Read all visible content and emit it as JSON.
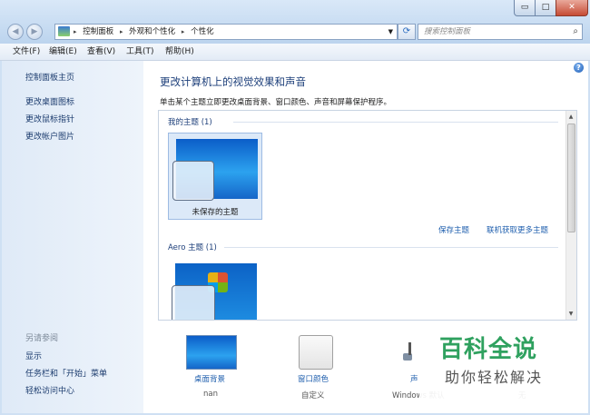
{
  "window": {
    "controls": {
      "minimize": "▭",
      "maximize": "□",
      "close": "✕"
    }
  },
  "address_bar": {
    "crumbs": [
      "控制面板",
      "外观和个性化",
      "个性化"
    ],
    "separator": "▸",
    "search_placeholder": "搜索控制面板"
  },
  "menu": {
    "file": "文件(F)",
    "edit": "编辑(E)",
    "view": "查看(V)",
    "tools": "工具(T)",
    "help": "帮助(H)"
  },
  "sidebar": {
    "home": "控制面板主页",
    "links": [
      "更改桌面图标",
      "更改鼠标指针",
      "更改帐户图片"
    ],
    "see_also_title": "另请参阅",
    "see_also": [
      "显示",
      "任务栏和「开始」菜单",
      "轻松访问中心"
    ]
  },
  "main": {
    "title": "更改计算机上的视觉效果和声音",
    "description": "单击某个主题立即更改桌面背景、窗口颜色、声音和屏幕保护程序。",
    "my_themes_header": "我的主题 (1)",
    "unsaved_theme_label": "未保存的主题",
    "save_theme": "保存主题",
    "get_more_themes": "联机获取更多主题",
    "aero_header": "Aero 主题 (1)"
  },
  "bottom": {
    "desktop_background": {
      "label": "桌面背景",
      "value": "nan"
    },
    "window_color": {
      "label": "窗口颜色",
      "value": "自定义"
    },
    "sounds": {
      "label": "声",
      "value": "Windows 默认"
    },
    "screensaver_value": "无"
  },
  "watermark": {
    "title": "百科全说",
    "subtitle": "助你轻松解决"
  },
  "colors": {
    "link": "#1f5fae",
    "title": "#1d3f7a",
    "watermark": "#2fa15f"
  },
  "icons": [
    "back-icon",
    "forward-icon",
    "control-panel-icon",
    "refresh-icon",
    "search-icon",
    "help-icon"
  ]
}
